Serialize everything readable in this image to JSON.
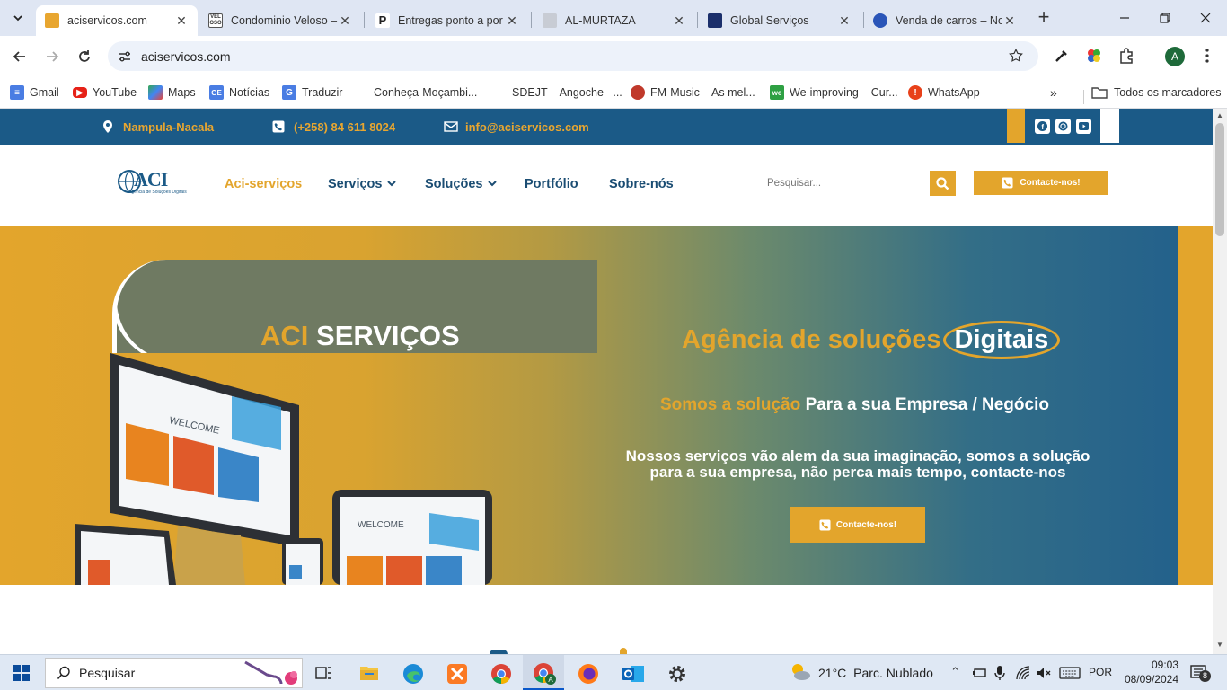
{
  "browser": {
    "tabs": [
      {
        "title": "aciservicos.com",
        "active": true
      },
      {
        "title": "Condominio Veloso – "
      },
      {
        "title": "Entregas ponto a por"
      },
      {
        "title": "AL-MURTAZA"
      },
      {
        "title": "Global Serviços"
      },
      {
        "title": "Venda de carros – No"
      }
    ],
    "address": "aciservicos.com",
    "profile_initial": "A",
    "bookmarks": [
      {
        "label": "Gmail"
      },
      {
        "label": "YouTube"
      },
      {
        "label": "Maps"
      },
      {
        "label": "Notícias"
      },
      {
        "label": "Traduzir"
      },
      {
        "label": "Conheça-Moçambi..."
      },
      {
        "label": "SDEJT – Angoche –..."
      },
      {
        "label": "FM-Music – As mel..."
      },
      {
        "label": "We-improving – Cur..."
      },
      {
        "label": "WhatsApp"
      }
    ],
    "all_bookmarks_label": "Todos os marcadores"
  },
  "site": {
    "topbar": {
      "location": "Nampula-Nacala",
      "phone": "(+258) 84 611 8024",
      "email": "info@aciservicos.com"
    },
    "logo": {
      "text": "ACI",
      "tagline": "Agência de Soluções Digitais"
    },
    "nav": [
      {
        "label": "Aci-serviços",
        "active": true
      },
      {
        "label": "Serviços",
        "dropdown": true
      },
      {
        "label": "Soluções",
        "dropdown": true
      },
      {
        "label": "Portfólio"
      },
      {
        "label": "Sobre-nós"
      }
    ],
    "search_placeholder": "Pesquisar...",
    "contact_button": "Contacte-nos!",
    "hero": {
      "title_accent": "ACI",
      "title_main": "SERVIÇOS",
      "heading_prefix": "Agência de soluções",
      "heading_highlight": "Digitais",
      "subheading_accent": "Somos a solução",
      "subheading_rest": "Para a sua Empresa / Negócio",
      "description_line1": "Nossos serviços vão alem da sua imaginação, somos a solução",
      "description_line2": "para a sua empresa, não perca mais tempo, contacte-nos",
      "cta": "Contacte-nos!",
      "mockup_welcome": "WELCOME"
    },
    "colors": {
      "primary": "#1b5a87",
      "accent": "#e8a630",
      "nav_text": "#1b4d73"
    }
  },
  "taskbar": {
    "search_label": "Pesquisar",
    "weather_temp": "21°C",
    "weather_desc": "Parc. Nublado",
    "language": "POR",
    "time": "09:03",
    "date": "08/09/2024",
    "notifications": "8"
  }
}
